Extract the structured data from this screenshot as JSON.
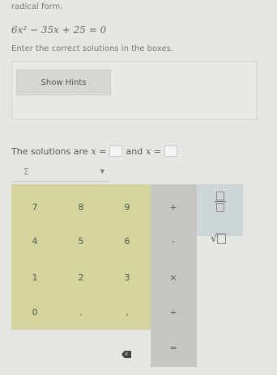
{
  "header": {
    "radical_text": "radical form.",
    "equation": "6x² − 35x + 25 = 0",
    "instruction": "Enter the correct solutions in the boxes."
  },
  "hints": {
    "button_label": "Show Hints"
  },
  "solution": {
    "prefix": "The solutions are",
    "var1": "x =",
    "connector": "and",
    "var2": "x ="
  },
  "dropdown": {
    "label": "Σ",
    "chevron": "▼"
  },
  "keypad": {
    "digits": [
      "7",
      "8",
      "9",
      "4",
      "5",
      "6",
      "1",
      "2",
      "3",
      "0",
      ".",
      ","
    ],
    "ops": [
      "+",
      "-",
      "×",
      "÷",
      "="
    ],
    "func_sqrt": "√"
  },
  "colors": {
    "numpad": "#d4d49d",
    "oppad": "#c6c6c3",
    "funcpad": "#cfd6da"
  }
}
